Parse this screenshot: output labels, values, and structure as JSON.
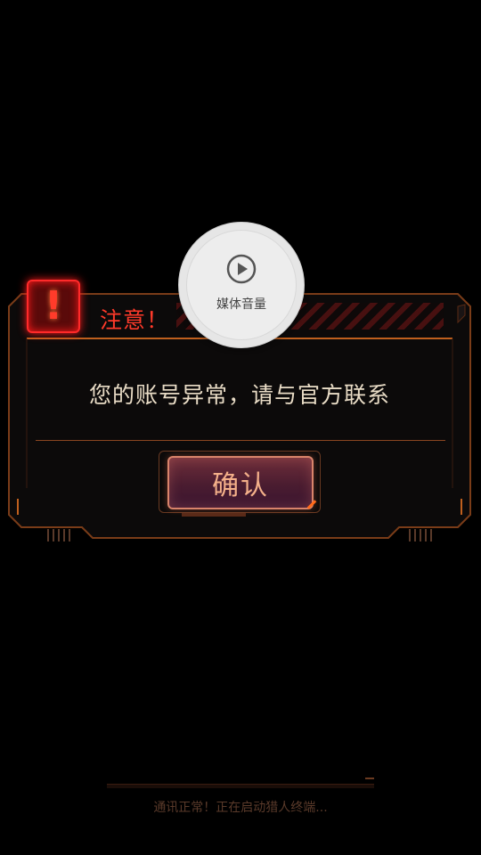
{
  "dialog": {
    "icon": "exclamation-icon",
    "icon_glyph": "!",
    "title": "注意！",
    "message": "您的账号异常，请与官方联系",
    "confirm_label": "确认"
  },
  "volume_overlay": {
    "icon": "play-circle-icon",
    "label": "媒体音量"
  },
  "status": {
    "text": "通讯正常！正在启动猎人终端..."
  },
  "colors": {
    "background": "#000000",
    "frame_orange": "#c0601e",
    "alert_red": "#ff2a2a",
    "title_red": "#ff3a2a",
    "message_text": "#e9dcc6",
    "button_text": "#f4b08a",
    "overlay_bg": "#e6e6e6"
  }
}
